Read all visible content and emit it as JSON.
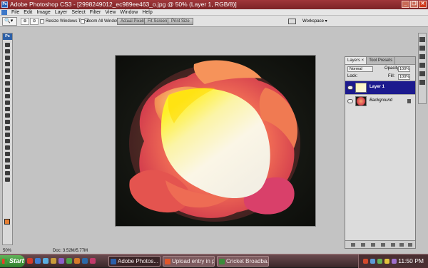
{
  "window": {
    "title": "Adobe Photoshop CS3 - [2998249012_ec989ee463_o.jpg @ 50% (Layer 1, RGB/8)]",
    "app_icon": "Ps",
    "buttons": {
      "minimize": "_",
      "restore": "❐",
      "close": "✕"
    }
  },
  "menubar": {
    "items": [
      "File",
      "Edit",
      "Image",
      "Layer",
      "Select",
      "Filter",
      "View",
      "Window",
      "Help"
    ]
  },
  "options_bar": {
    "tool_preset": "🔍▾",
    "zoom_in": "⊕",
    "zoom_out": "⊖",
    "resize_windows_label": "Resize Windows To Fit",
    "zoom_all_windows_label": "Zoom All Windows",
    "actual_pixels_label": "Actual Pixels",
    "fit_screen_label": "Fit Screen",
    "print_size_label": "Print Size",
    "workspace_label": "Workspace ▾"
  },
  "toolbox": {
    "logo": "Ps",
    "tools": [
      "move-tool",
      "marquee-tool",
      "lasso-tool",
      "magic-wand-tool",
      "crop-tool",
      "slice-tool",
      "healing-brush-tool",
      "brush-tool",
      "clone-stamp-tool",
      "history-brush-tool",
      "eraser-tool",
      "gradient-tool",
      "blur-tool",
      "dodge-tool",
      "pen-tool",
      "type-tool",
      "path-selection-tool",
      "shape-tool",
      "notes-tool",
      "eyedropper-tool",
      "hand-tool",
      "zoom-tool"
    ],
    "foreground_color": "#e67f33",
    "background_color": "#ffffff"
  },
  "status_bar": {
    "zoom": "50%",
    "doc_info": "Doc: 3.52M/5.77M"
  },
  "layers_panel": {
    "tabs": [
      "Layers ×",
      "Tool Presets"
    ],
    "blend_mode": "Normal",
    "opacity_label": "Opacity:",
    "opacity_value": "100%",
    "lock_label": "Lock:",
    "fill_label": "Fill:",
    "fill_value": "100%",
    "layers": [
      {
        "name": "Layer 1",
        "selected": true
      },
      {
        "name": "Background",
        "selected": false,
        "locked": true
      }
    ]
  },
  "taskbar": {
    "start_label": "Start",
    "tasks": [
      {
        "label": "Adobe Photos...",
        "active": true
      },
      {
        "label": "Upload entry in p...",
        "active": false
      },
      {
        "label": "Cricket Broadba...",
        "active": false
      }
    ],
    "clock": "11:50 PM"
  }
}
